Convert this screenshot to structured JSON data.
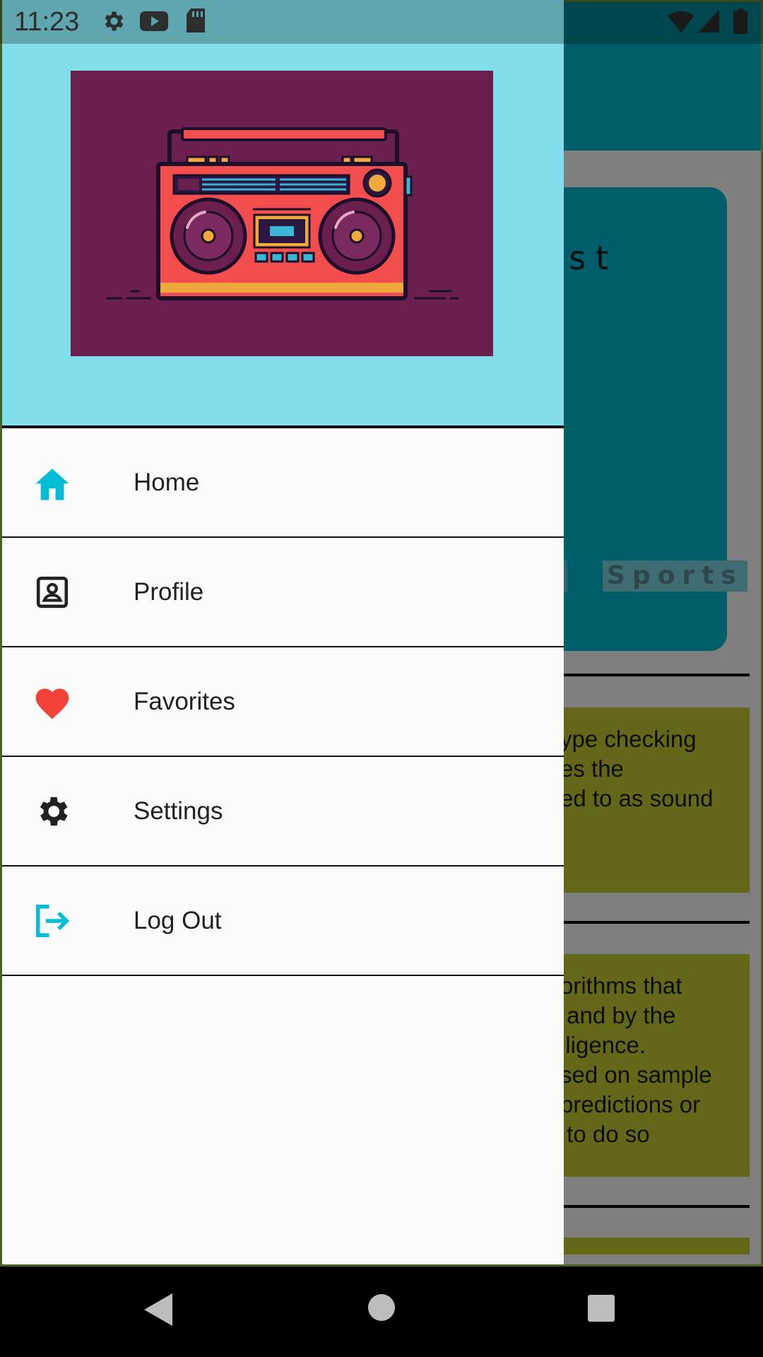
{
  "status_bar": {
    "time": "11:23",
    "left_icons": [
      "settings-icon",
      "youtube-icon",
      "sd-card-icon"
    ],
    "right_icons": [
      "wifi-icon",
      "cell-signal-icon",
      "battery-icon"
    ]
  },
  "background_screen": {
    "hero_title_fragment": "ast",
    "chip_label": "Sports",
    "article_1_fragment": "ype checking\nes the\ned to as sound",
    "article_2_fragment": "orithms that\n and by the\nlligence.\nsed on sample\npredictions or\n to do so",
    "colors": {
      "primary": "#00bcd4",
      "card": "#c6cf2f"
    }
  },
  "drawer": {
    "header_image": "boombox-illustration",
    "header_bg": "#81deea",
    "items": [
      {
        "label": "Home",
        "icon": "home-icon",
        "icon_color": "#00bcd4"
      },
      {
        "label": "Profile",
        "icon": "contact-icon",
        "icon_color": "#212121"
      },
      {
        "label": "Favorites",
        "icon": "heart-icon",
        "icon_color": "#f44336"
      },
      {
        "label": "Settings",
        "icon": "gear-icon",
        "icon_color": "#212121"
      },
      {
        "label": "Log Out",
        "icon": "logout-icon",
        "icon_color": "#00bcd4"
      }
    ]
  },
  "nav_bar": {
    "buttons": [
      "back",
      "home",
      "recents"
    ]
  }
}
